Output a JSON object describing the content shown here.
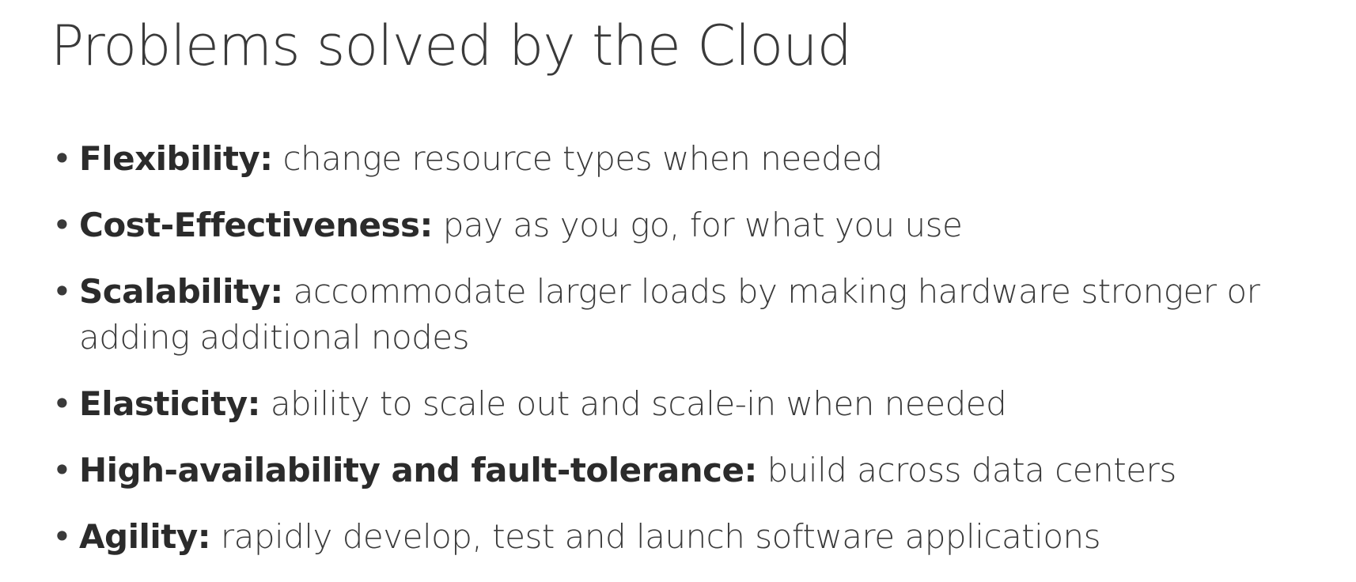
{
  "slide": {
    "title": "Problems solved by the Cloud",
    "bullets": [
      {
        "term": "Flexibility:",
        "description": "change resource types when needed"
      },
      {
        "term": "Cost-Effectiveness:",
        "description": "pay as you go, for what you use"
      },
      {
        "term": "Scalability:",
        "description": "accommodate larger loads by making hardware stronger or adding additional nodes"
      },
      {
        "term": "Elasticity:",
        "description": "ability to scale out and scale-in when needed"
      },
      {
        "term": "High-availability and fault-tolerance:",
        "description": "build across data centers"
      },
      {
        "term": "Agility:",
        "description": "rapidly develop, test and launch software applications"
      }
    ]
  }
}
